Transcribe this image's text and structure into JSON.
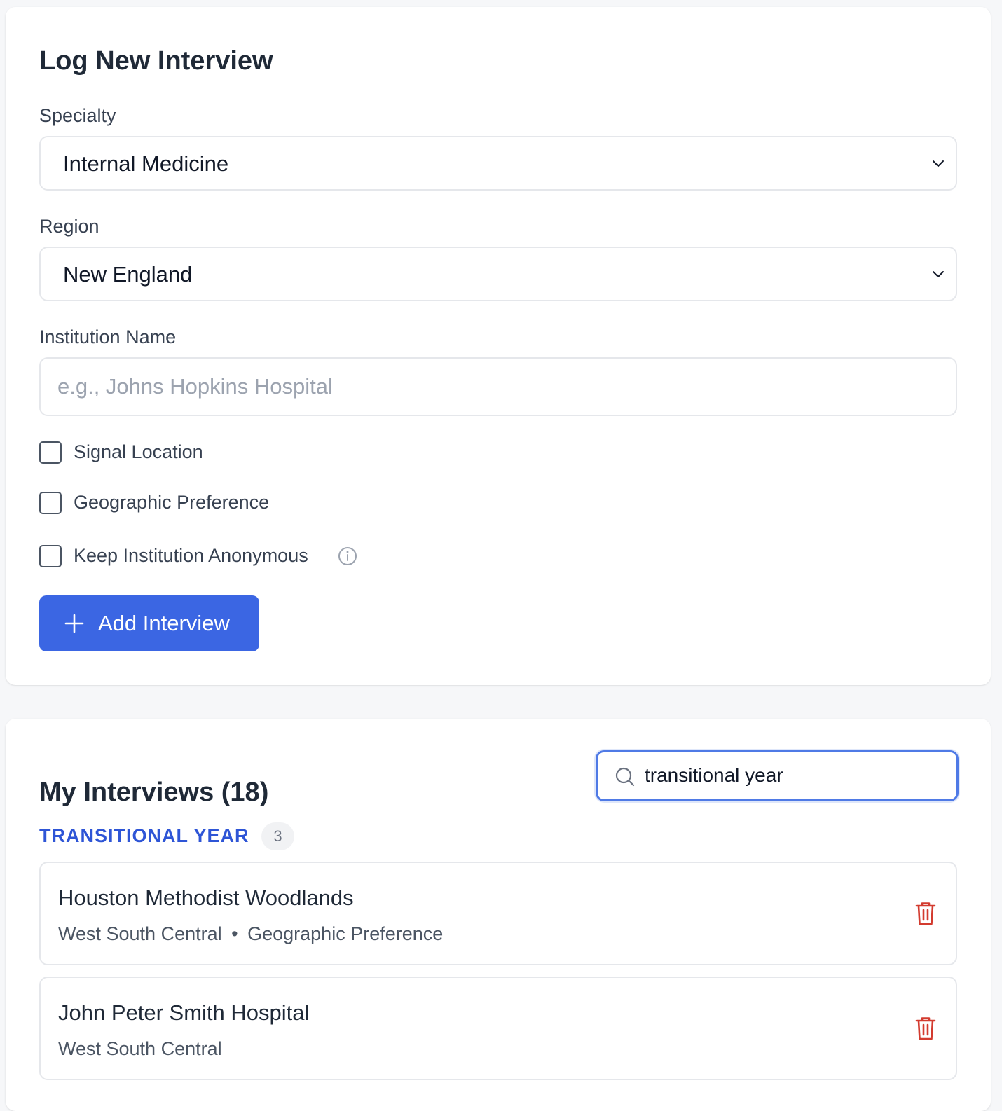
{
  "form": {
    "title": "Log New Interview",
    "specialty_label": "Specialty",
    "specialty_value": "Internal Medicine",
    "region_label": "Region",
    "region_value": "New England",
    "institution_label": "Institution Name",
    "institution_placeholder": "e.g., Johns Hopkins Hospital",
    "institution_value": "",
    "checkboxes": [
      {
        "label": "Signal Location",
        "checked": false
      },
      {
        "label": "Geographic Preference",
        "checked": false
      },
      {
        "label": "Keep Institution Anonymous",
        "checked": false
      }
    ],
    "add_button_label": "Add Interview"
  },
  "list": {
    "title": "My Interviews (18)",
    "search_value": "transitional year",
    "group": {
      "label": "TRANSITIONAL YEAR",
      "count": "3"
    },
    "items": [
      {
        "name": "Houston Methodist Woodlands",
        "region": "West South Central",
        "sep": "•",
        "preference": "Geographic Preference"
      },
      {
        "name": "John Peter Smith Hospital",
        "region": "West South Central"
      }
    ]
  },
  "colors": {
    "accent": "#3b66e3",
    "group_label": "#2e55d6",
    "delete": "#d33b2f"
  },
  "icons": [
    "chevron-down-icon",
    "info-icon",
    "plus-icon",
    "search-icon",
    "trash-icon"
  ]
}
